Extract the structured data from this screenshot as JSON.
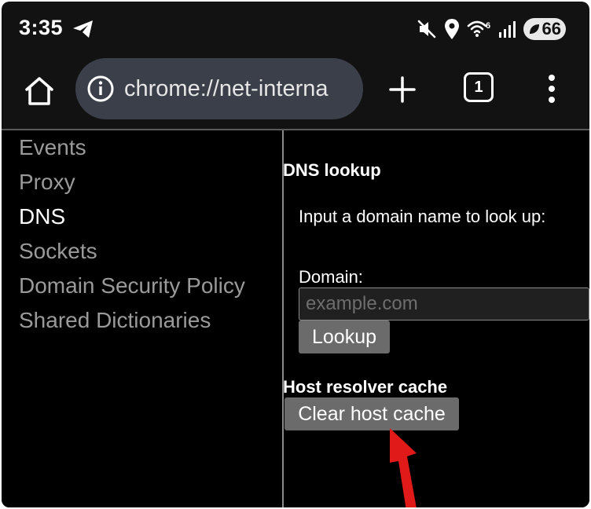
{
  "status_bar": {
    "time": "3:35",
    "battery_level": "66",
    "icons": [
      "telegram-icon",
      "mute-icon",
      "location-icon",
      "wifi-6-icon",
      "signal-icon",
      "battery-saver-icon"
    ],
    "wifi_badge": "6"
  },
  "toolbar": {
    "url": "chrome://net-interna",
    "tab_count": "1",
    "icons": [
      "home-icon",
      "info-icon",
      "plus-icon",
      "tab-switcher-icon",
      "more-vert-icon"
    ]
  },
  "sidebar": {
    "items": [
      {
        "label": "Events",
        "active": false
      },
      {
        "label": "Proxy",
        "active": false
      },
      {
        "label": "DNS",
        "active": true
      },
      {
        "label": "Sockets",
        "active": false
      },
      {
        "label": "Domain Security Policy",
        "active": false
      },
      {
        "label": "Shared Dictionaries",
        "active": false
      }
    ]
  },
  "main": {
    "dns_lookup_title": "DNS lookup",
    "description": "Input a domain name to look up:",
    "domain_label": "Domain:",
    "domain_placeholder": "example.com",
    "domain_value": "",
    "lookup_label": "Lookup",
    "cache_title": "Host resolver cache",
    "clear_cache_label": "Clear host cache"
  },
  "colors": {
    "background": "#000000",
    "omnibox": "#3a3f4a",
    "button": "#6b6b6b",
    "inactive_text": "#9a9a9a",
    "annotation_arrow": "#e01919"
  }
}
